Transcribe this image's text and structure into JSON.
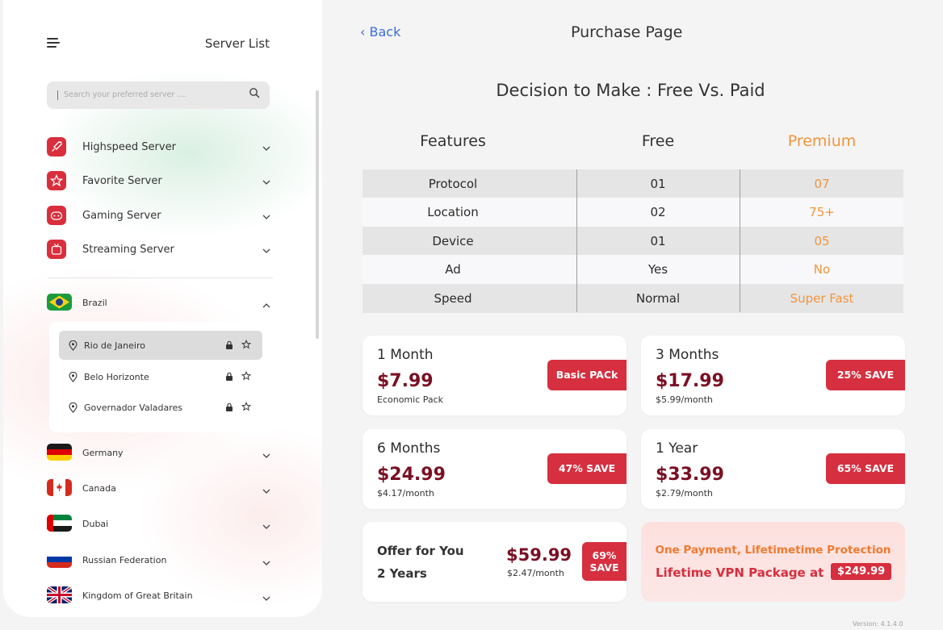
{
  "sidebar": {
    "title": "Server List",
    "search_placeholder": "Search your preferred server ....",
    "categories": [
      {
        "label": "Highspeed Server",
        "icon": "rocket-icon"
      },
      {
        "label": "Favorite Server",
        "icon": "star-icon"
      },
      {
        "label": "Gaming Server",
        "icon": "gamepad-icon"
      },
      {
        "label": "Streaming Server",
        "icon": "tv-icon"
      }
    ],
    "expanded_country": {
      "name": "Brazil",
      "cities": [
        {
          "name": "Rio de Janeiro",
          "selected": true
        },
        {
          "name": "Belo Horizonte",
          "selected": false
        },
        {
          "name": "Governador Valadares",
          "selected": false
        }
      ]
    },
    "countries": [
      "Germany",
      "Canada",
      "Dubai",
      "Russian Federation",
      "Kingdom of Great Britain"
    ]
  },
  "header": {
    "back_label": "Back",
    "title": "Purchase Page"
  },
  "comparison": {
    "heading": "Decision to Make : Free Vs. Paid",
    "columns": [
      "Features",
      "Free",
      "Premium"
    ],
    "rows": [
      {
        "feature": "Protocol",
        "free": "01",
        "premium": "07"
      },
      {
        "feature": "Location",
        "free": "02",
        "premium": "75+"
      },
      {
        "feature": "Device",
        "free": "01",
        "premium": "05"
      },
      {
        "feature": "Ad",
        "free": "Yes",
        "premium": "No"
      },
      {
        "feature": "Speed",
        "free": "Normal",
        "premium": "Super Fast"
      }
    ]
  },
  "plans": [
    {
      "term": "1 Month",
      "price": "$7.99",
      "sub": "Economic Pack",
      "badge": "Basic PACk"
    },
    {
      "term": "3 Months",
      "price": "$17.99",
      "sub": "$5.99/month",
      "badge": "25% SAVE"
    },
    {
      "term": "6 Months",
      "price": "$24.99",
      "sub": "$4.17/month",
      "badge": "47% SAVE"
    },
    {
      "term": "1 Year",
      "price": "$33.99",
      "sub": "$2.79/month",
      "badge": "65% SAVE"
    }
  ],
  "offer": {
    "title": "Offer for You",
    "term": "2 Years",
    "price": "$59.99",
    "sub": "$2.47/month",
    "badge_line1": "69%",
    "badge_line2": "SAVE"
  },
  "lifetime": {
    "line1": "One Payment, Lifetimetime Protection",
    "line2": "Lifetime VPN Package at",
    "price": "$249.99"
  },
  "version": "Version: 4.1.4.0",
  "colors": {
    "accent_red": "#d62f3f",
    "price_maroon": "#7a1023",
    "premium_orange": "#f0953a",
    "link_blue": "#3a6fd8"
  }
}
